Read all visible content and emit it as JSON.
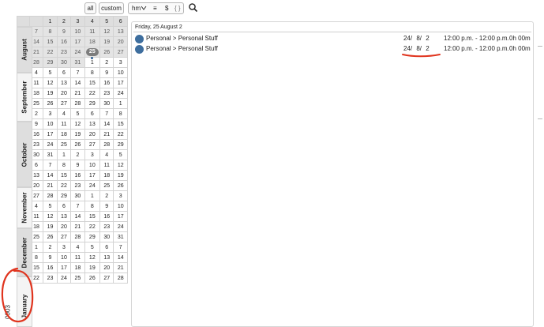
{
  "toolbar": {
    "all_label": "all",
    "custom_label": "custom",
    "time_format": "hm",
    "list_symbol": "≡",
    "currency_symbol": "$",
    "braces_symbol": "{ }"
  },
  "calendar": {
    "weekday_row": [
      "",
      "",
      "1",
      "2",
      "3",
      "4",
      "5",
      "6"
    ],
    "weeks": [
      [
        "7",
        "8",
        "9",
        "10",
        "11",
        "12",
        "13"
      ],
      [
        "14",
        "15",
        "16",
        "17",
        "18",
        "19",
        "20"
      ],
      [
        "21",
        "22",
        "23",
        "24",
        "25",
        "26",
        "27"
      ],
      [
        "28",
        "29",
        "30",
        "31",
        "1",
        "2",
        "3"
      ],
      [
        "4",
        "5",
        "6",
        "7",
        "8",
        "9",
        "10"
      ],
      [
        "11",
        "12",
        "13",
        "14",
        "15",
        "16",
        "17"
      ],
      [
        "18",
        "19",
        "20",
        "21",
        "22",
        "23",
        "24"
      ],
      [
        "25",
        "26",
        "27",
        "28",
        "29",
        "30",
        "1"
      ],
      [
        "2",
        "3",
        "4",
        "5",
        "6",
        "7",
        "8"
      ],
      [
        "9",
        "10",
        "11",
        "12",
        "13",
        "14",
        "15"
      ],
      [
        "16",
        "17",
        "18",
        "19",
        "20",
        "21",
        "22"
      ],
      [
        "23",
        "24",
        "25",
        "26",
        "27",
        "28",
        "29"
      ],
      [
        "30",
        "31",
        "1",
        "2",
        "3",
        "4",
        "5"
      ],
      [
        "6",
        "7",
        "8",
        "9",
        "10",
        "11",
        "12"
      ],
      [
        "13",
        "14",
        "15",
        "16",
        "17",
        "18",
        "19"
      ],
      [
        "20",
        "21",
        "22",
        "23",
        "24",
        "25",
        "26"
      ],
      [
        "27",
        "28",
        "29",
        "30",
        "1",
        "2",
        "3"
      ],
      [
        "4",
        "5",
        "6",
        "7",
        "8",
        "9",
        "10"
      ],
      [
        "11",
        "12",
        "13",
        "14",
        "15",
        "16",
        "17"
      ],
      [
        "18",
        "19",
        "20",
        "21",
        "22",
        "23",
        "24"
      ],
      [
        "25",
        "26",
        "27",
        "28",
        "29",
        "30",
        "31"
      ],
      [
        "1",
        "2",
        "3",
        "4",
        "5",
        "6",
        "7"
      ],
      [
        "8",
        "9",
        "10",
        "11",
        "12",
        "13",
        "14"
      ],
      [
        "15",
        "16",
        "17",
        "18",
        "19",
        "20",
        "21"
      ],
      [
        "22",
        "23",
        "24",
        "25",
        "26",
        "27",
        "28"
      ]
    ],
    "months": [
      "August",
      "September",
      "October",
      "November",
      "December",
      "January"
    ],
    "year_label": "0003",
    "today": "25"
  },
  "events": {
    "day_header": "Friday, 25 August 2",
    "rows": [
      {
        "title": "Personal > Personal Stuff",
        "date": "24/ 8/ 2",
        "time": "12:00 p.m. - 12:00 p.m.",
        "duration": "0h 00m"
      },
      {
        "title": "Personal > Personal Stuff",
        "date": "24/ 8/ 2",
        "time": "12:00 p.m. - 12:00 p.m.",
        "duration": "0h 00m"
      }
    ]
  },
  "colors": {
    "event_dot": "#3e6e9e",
    "annotation": "#e0341e",
    "today_pill": "#7d7d7d"
  }
}
